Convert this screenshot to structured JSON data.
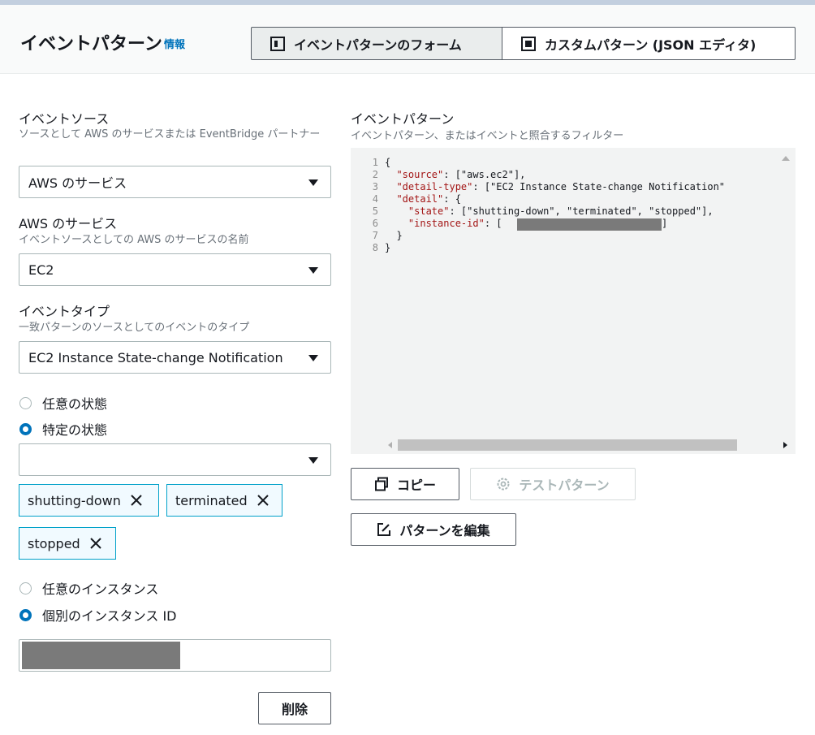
{
  "header": {
    "title": "イベントパターン",
    "info": "情報",
    "tab_form": "イベントパターンのフォーム",
    "tab_custom": "カスタムパターン (JSON エディタ)"
  },
  "event_source": {
    "label": "イベントソース",
    "description": "ソースとして AWS のサービスまたは EventBridge パートナー",
    "value": "AWS のサービス"
  },
  "aws_service": {
    "label": "AWS のサービス",
    "description": "イベントソースとしての AWS のサービスの名前",
    "value": "EC2"
  },
  "event_type": {
    "label": "イベントタイプ",
    "description": "一致パターンのソースとしてのイベントのタイプ",
    "value": "EC2 Instance State-change Notification"
  },
  "state": {
    "any": "任意の状態",
    "specific": "特定の状態",
    "tokens": [
      "shutting-down",
      "terminated",
      "stopped"
    ]
  },
  "instance": {
    "any": "任意のインスタンス",
    "specific": "個別のインスタンス ID"
  },
  "delete_button": "削除",
  "pattern": {
    "label": "イベントパターン",
    "description": "イベントパターン、またはイベントと照合するフィルター",
    "lines": [
      {
        "n": "1",
        "text": "{"
      },
      {
        "n": "2",
        "key": "\"source\"",
        "rest": ": [\"aws.ec2\"],"
      },
      {
        "n": "3",
        "key": "\"detail-type\"",
        "rest": ": [\"EC2 Instance State-change Notification\""
      },
      {
        "n": "4",
        "key": "\"detail\"",
        "rest": ": {"
      },
      {
        "n": "5",
        "key": "\"state\"",
        "rest": ": [\"shutting-down\", \"terminated\", \"stopped\"],"
      },
      {
        "n": "6",
        "key": "\"instance-id\"",
        "rest": ": ["
      },
      {
        "n": "7",
        "text": "  }"
      },
      {
        "n": "8",
        "text": "}"
      }
    ]
  },
  "buttons": {
    "copy": "コピー",
    "test": "テストパターン",
    "edit": "パターンを編集"
  }
}
